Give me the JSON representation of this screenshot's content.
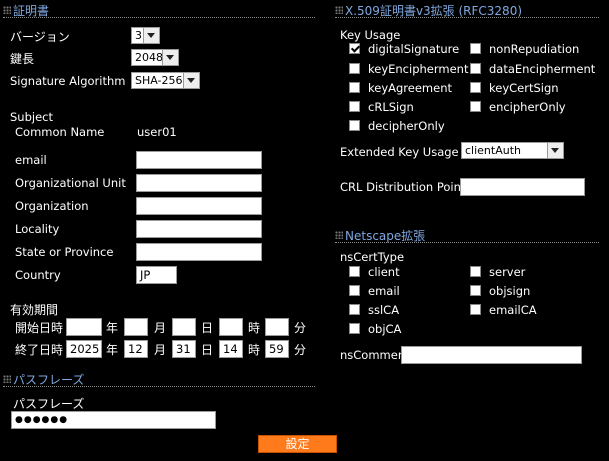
{
  "left": {
    "cert_title": "証明書",
    "version_label": "バージョン",
    "version_value": "3",
    "keylen_label": "鍵長",
    "keylen_value": "2048",
    "sigalg_label": "Signature Algorithm",
    "sigalg_value": "SHA-256",
    "subject_label": "Subject",
    "cn_label": "Common Name",
    "cn_value": "user01",
    "email_label": "email",
    "email_value": "",
    "ou_label": "Organizational Unit",
    "ou_value": "",
    "org_label": "Organization",
    "org_value": "",
    "loc_label": "Locality",
    "loc_value": "",
    "state_label": "State or Province",
    "state_value": "",
    "country_label": "Country",
    "country_value": "JP",
    "validity_label": "有効期間",
    "start_label": "開始日時",
    "end_label": "終了日時",
    "unit_year": "年",
    "unit_month": "月",
    "unit_day": "日",
    "unit_hour": "時",
    "unit_min": "分",
    "start": {
      "year": "",
      "month": "",
      "day": "",
      "hour": "",
      "min": ""
    },
    "end": {
      "year": "2025",
      "month": "12",
      "day": "31",
      "hour": "14",
      "min": "59"
    },
    "pass_title": "パスフレーズ",
    "pass_label": "パスフレーズ",
    "pass_value": "●●●●●●",
    "submit_label": "設定"
  },
  "right": {
    "ext_title": "X.509証明書v3拡張 (RFC3280)",
    "ku_label": "Key Usage",
    "ku": {
      "digitalSignature": "digitalSignature",
      "nonRepudiation": "nonRepudiation",
      "keyEncipherment": "keyEncipherment",
      "dataEncipherment": "dataEncipherment",
      "keyAgreement": "keyAgreement",
      "keyCertSign": "keyCertSign",
      "cRLSign": "cRLSign",
      "encipherOnly": "encipherOnly",
      "decipherOnly": "decipherOnly"
    },
    "eku_label": "Extended Key Usage",
    "eku_value": "clientAuth",
    "crl_label": "CRL Distribution Points",
    "crl_value": "",
    "ns_title": "Netscape拡張",
    "nsct_label": "nsCertType",
    "ns": {
      "client": "client",
      "server": "server",
      "email": "email",
      "objsign": "objsign",
      "sslCA": "sslCA",
      "emailCA": "emailCA",
      "objCA": "objCA"
    },
    "nscomment_label": "nsComment",
    "nscomment_value": ""
  }
}
